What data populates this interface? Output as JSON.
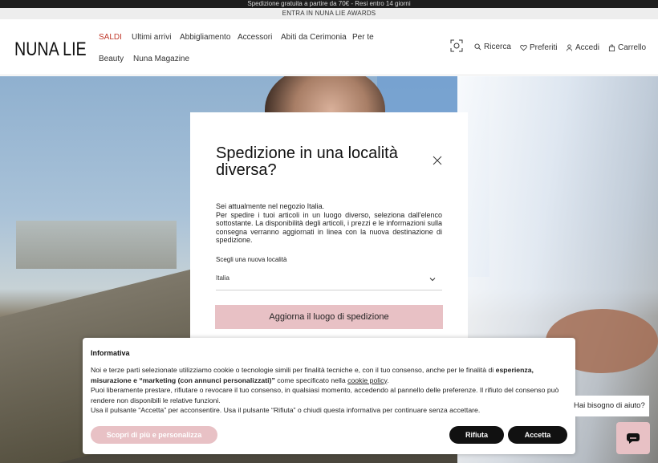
{
  "promo": {
    "line1": "Spedizione gratuita a partire da 70€ - Resi entro 14 giorni",
    "line2": "ENTRA IN NUNA LIE AWARDS"
  },
  "header": {
    "logo": "NUNA LIE",
    "nav": [
      "SALDI",
      "Ultimi arrivi",
      "Abbigliamento",
      "Accessori",
      "Abiti da Cerimonia",
      "Per te",
      "Beauty",
      "Nuna Magazine"
    ],
    "tools": {
      "search": "Ricerca",
      "favorites": "Preferiti",
      "login": "Accedi",
      "cart": "Carrello"
    }
  },
  "modal": {
    "title": "Spedizione in una località diversa?",
    "line1": "Sei attualmente nel negozio Italia.",
    "body": "Per spedire i tuoi articoli in un luogo diverso, seleziona dall'elenco sottostante. La disponibilità degli articoli, i prezzi e le informazioni sulla consegna verranno aggiornati in linea con la nuova destinazione di spedizione.",
    "select_label": "Scegli una nuova località",
    "select_value": "Italia",
    "button": "Aggiorna il luogo di spedizione"
  },
  "cookie": {
    "title": "Informativa",
    "p1_start": "Noi e terze parti selezionate utilizziamo cookie o tecnologie simili per finalità tecniche e, con il tuo consenso, anche per le finalità di ",
    "p1_bold": "esperienza, misurazione e “marketing (con annunci personalizzati)”",
    "p1_mid": " come specificato nella ",
    "p1_link": "cookie policy",
    "p1_end": ".",
    "p2": "Puoi liberamente prestare, rifiutare o revocare il tuo consenso, in qualsiasi momento, accedendo al pannello delle preferenze. Il rifiuto del consenso può rendere non disponibili le relative funzioni.",
    "p3": "Usa il pulsante “Accetta” per acconsentire. Usa il pulsante “Rifiuta” o chiudi questa informativa per continuare senza accettare.",
    "btn_more": "Scopri di più e personalizza",
    "btn_reject": "Rifiuta",
    "btn_accept": "Accetta"
  },
  "help": {
    "text": "Hai bisogno di aiuto?"
  },
  "colors": {
    "accent_pink": "#e8c1c5",
    "sale_red": "#c0392b",
    "dark": "#111111"
  }
}
